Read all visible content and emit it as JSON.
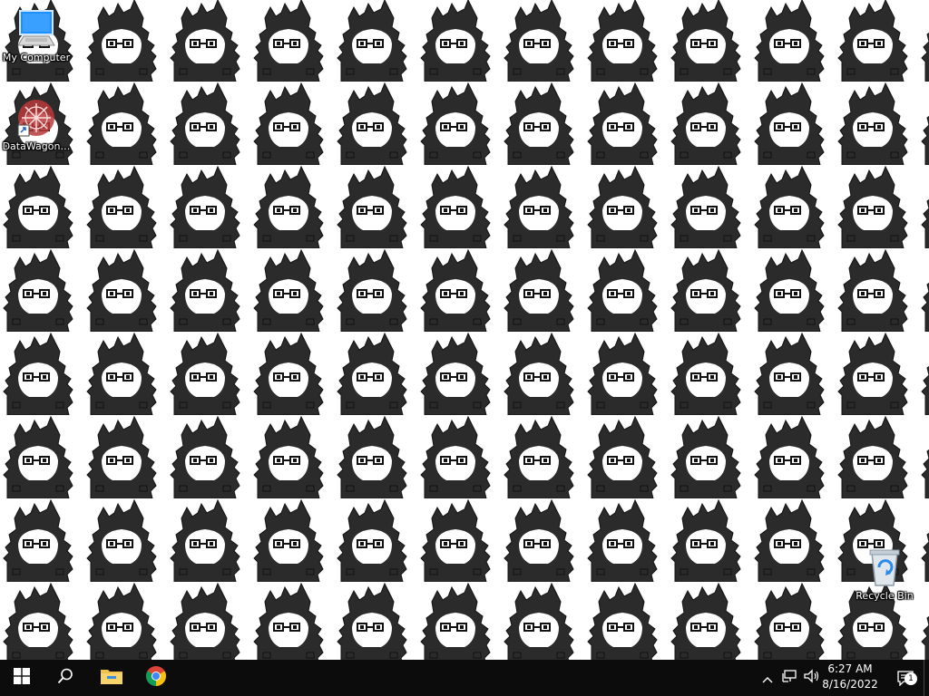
{
  "desktop": {
    "wallpaper": {
      "description_icon": "cat-creature-tile-icon",
      "background_color": "#ffffff",
      "figure_color": "#2b2b2b"
    },
    "icons": [
      {
        "id": "my-computer",
        "label": "My Computer",
        "icon": "computer-icon"
      },
      {
        "id": "datawagon",
        "label": "DataWagon…",
        "icon": "datawagon-icon"
      },
      {
        "id": "recycle-bin",
        "label": "Recycle Bin",
        "icon": "recycle-bin-icon"
      }
    ]
  },
  "taskbar": {
    "background": "#0c0c0c",
    "start_icon": "windows-logo-icon",
    "search_icon": "search-icon",
    "pinned": [
      {
        "id": "file-explorer",
        "icon": "folder-icon"
      },
      {
        "id": "chrome",
        "icon": "chrome-icon"
      }
    ],
    "tray": {
      "chevron_icon": "chevron-up-icon",
      "network_icon": "network-icon",
      "volume_icon": "volume-icon",
      "time": "6:27 AM",
      "date": "8/16/2022",
      "notification_icon": "notification-icon",
      "notification_count": "1"
    }
  }
}
